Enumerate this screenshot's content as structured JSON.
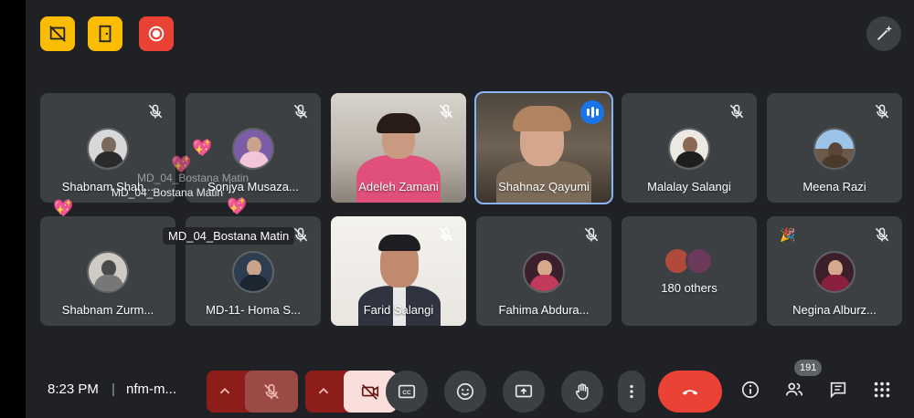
{
  "top_controls": {
    "host_icon_1": "no-chat-icon",
    "host_icon_2": "leave-door-icon",
    "recording_icon": "record-icon",
    "effects_icon": "magic-wand-icon"
  },
  "participants": [
    {
      "name": "Shabnam Shah...",
      "muted": true
    },
    {
      "name": "Sonjya Musaza...",
      "muted": true
    },
    {
      "name": "Adeleh Zamani",
      "muted": true
    },
    {
      "name": "Shahnaz Qayumi",
      "muted": false,
      "speaking": true
    },
    {
      "name": "Malalay Salangi",
      "muted": true
    },
    {
      "name": "Meena Razi",
      "muted": true
    },
    {
      "name": "Shabnam Zurm...",
      "muted": false
    },
    {
      "name": "MD-11- Homa S...",
      "muted": true
    },
    {
      "name": "Farid Salangi",
      "muted": true
    },
    {
      "name": "Fahima Abdura...",
      "muted": true
    },
    {
      "name": "180 others",
      "muted": false
    },
    {
      "name": "Negina Alburz...",
      "muted": true
    }
  ],
  "overlays": {
    "reaction_sender_label": "MD_04_Bostana Matin",
    "faded_label_top": "MD_04_Bostana Matin",
    "faded_label_behind": "MD_04_Bostana Matin"
  },
  "bottom_bar": {
    "time": "8:23 PM",
    "separator": "|",
    "meeting_code": "nfm-m...",
    "people_count": "191"
  },
  "colors": {
    "background": "#202124",
    "tile": "#3c4043",
    "accent_blue": "#1a73e8",
    "end_call_red": "#ea4335",
    "host_yellow": "#fbbc04",
    "muted_control_red": "#8c1d18"
  }
}
